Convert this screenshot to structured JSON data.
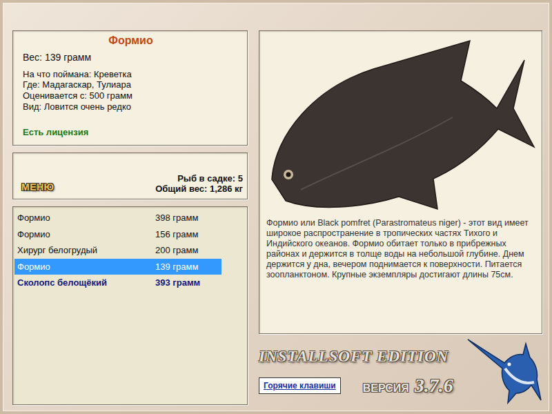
{
  "fish_card": {
    "title": "Формио",
    "weight": "Вес: 139 грамм",
    "details": [
      "На что поймана: Креветка",
      "Где: Мадагаскар, Тулиара",
      "Оценивается с: 500 грамм",
      "Вид: Ловится очень редко"
    ],
    "license": "Есть лицензия"
  },
  "menu_button": "МЕНЮ",
  "keepnet": {
    "count": "Рыб в садке: 5",
    "total": "Общий вес: 1,286 кг"
  },
  "catch_list": [
    {
      "name": "Формио",
      "weight": "398 грамм",
      "selected": false,
      "emphasized": false
    },
    {
      "name": "Формио",
      "weight": "156 грамм",
      "selected": false,
      "emphasized": false
    },
    {
      "name": "Хирург белогрудый",
      "weight": "200 грамм",
      "selected": false,
      "emphasized": false
    },
    {
      "name": "Формио",
      "weight": "139 грамм",
      "selected": true,
      "emphasized": false
    },
    {
      "name": "Сколопс белощёкий",
      "weight": "393 грамм",
      "selected": false,
      "emphasized": true
    }
  ],
  "description": "Формио или Black pomfret (Parastromateus niger) - этот вид имеет широкое распространение в тропических частях Тихого и Индийского океанов. Формио обитает только в прибрежных районах и держится в толще воды на небольшой глубине. Днем держится у дна, вечером поднимается к поверхности. Питается зоопланктоном. Крупные экземпляры достигают длины 75см.",
  "edition": "INSTALLSOFT EDITION",
  "version_label": "ВЕРСИЯ",
  "version": "3.7.6",
  "hotkeys_button": "Горячие клавиши"
}
